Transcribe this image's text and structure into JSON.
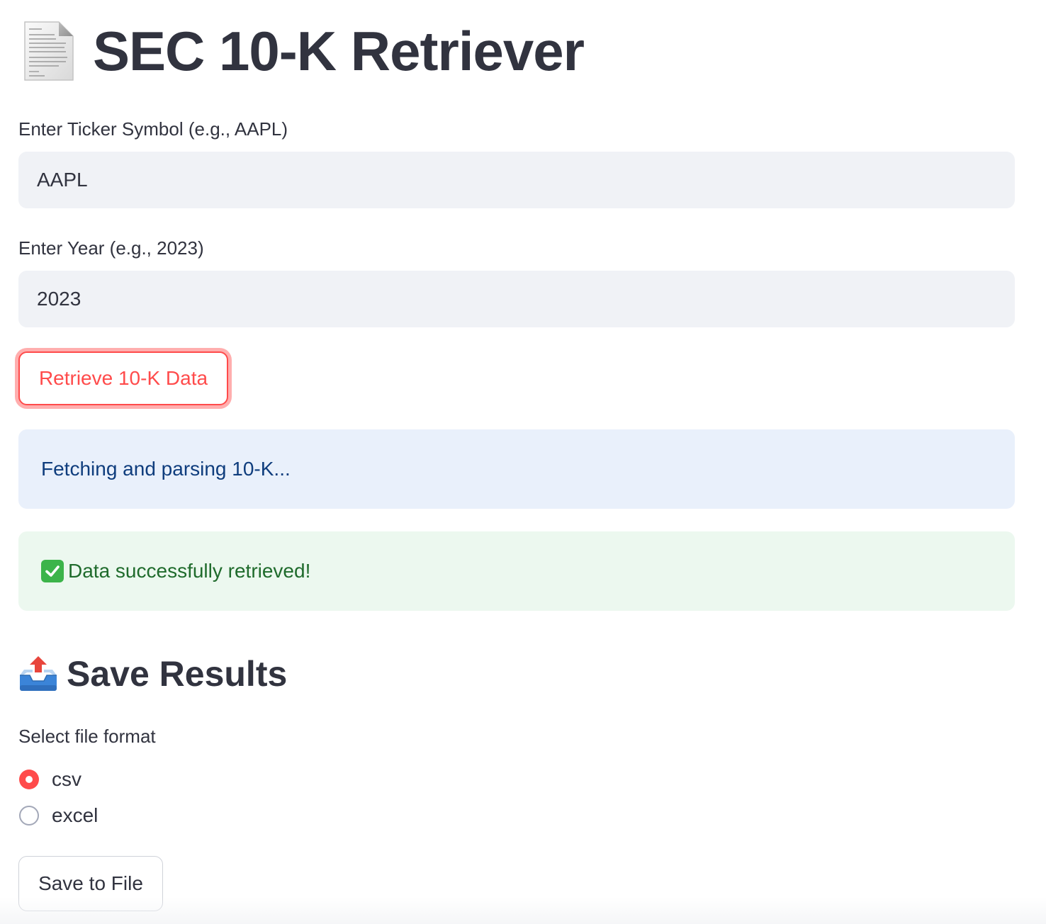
{
  "header": {
    "icon": "page-document-icon",
    "title": "SEC 10-K Retriever"
  },
  "ticker": {
    "label": "Enter Ticker Symbol (e.g., AAPL)",
    "value": "AAPL"
  },
  "year": {
    "label": "Enter Year (e.g., 2023)",
    "value": "2023"
  },
  "retrieve_button": {
    "label": "Retrieve 10-K Data"
  },
  "info_alert": {
    "text": "Fetching and parsing 10-K..."
  },
  "success_alert": {
    "icon": "check-mark-icon",
    "text": "Data successfully retrieved!"
  },
  "save_section": {
    "icon": "outbox-tray-icon",
    "title": "Save Results",
    "format_label": "Select file format",
    "options": [
      {
        "label": "csv",
        "selected": true
      },
      {
        "label": "excel",
        "selected": false
      }
    ],
    "save_button": "Save to File"
  },
  "colors": {
    "primary": "#ff4b4b",
    "text": "#31333f",
    "input_bg": "#f0f2f6",
    "info_bg": "#e9f0fb",
    "info_text": "#0f3d7d",
    "success_bg": "#ecf8ef",
    "success_text": "#1f6b2c"
  }
}
